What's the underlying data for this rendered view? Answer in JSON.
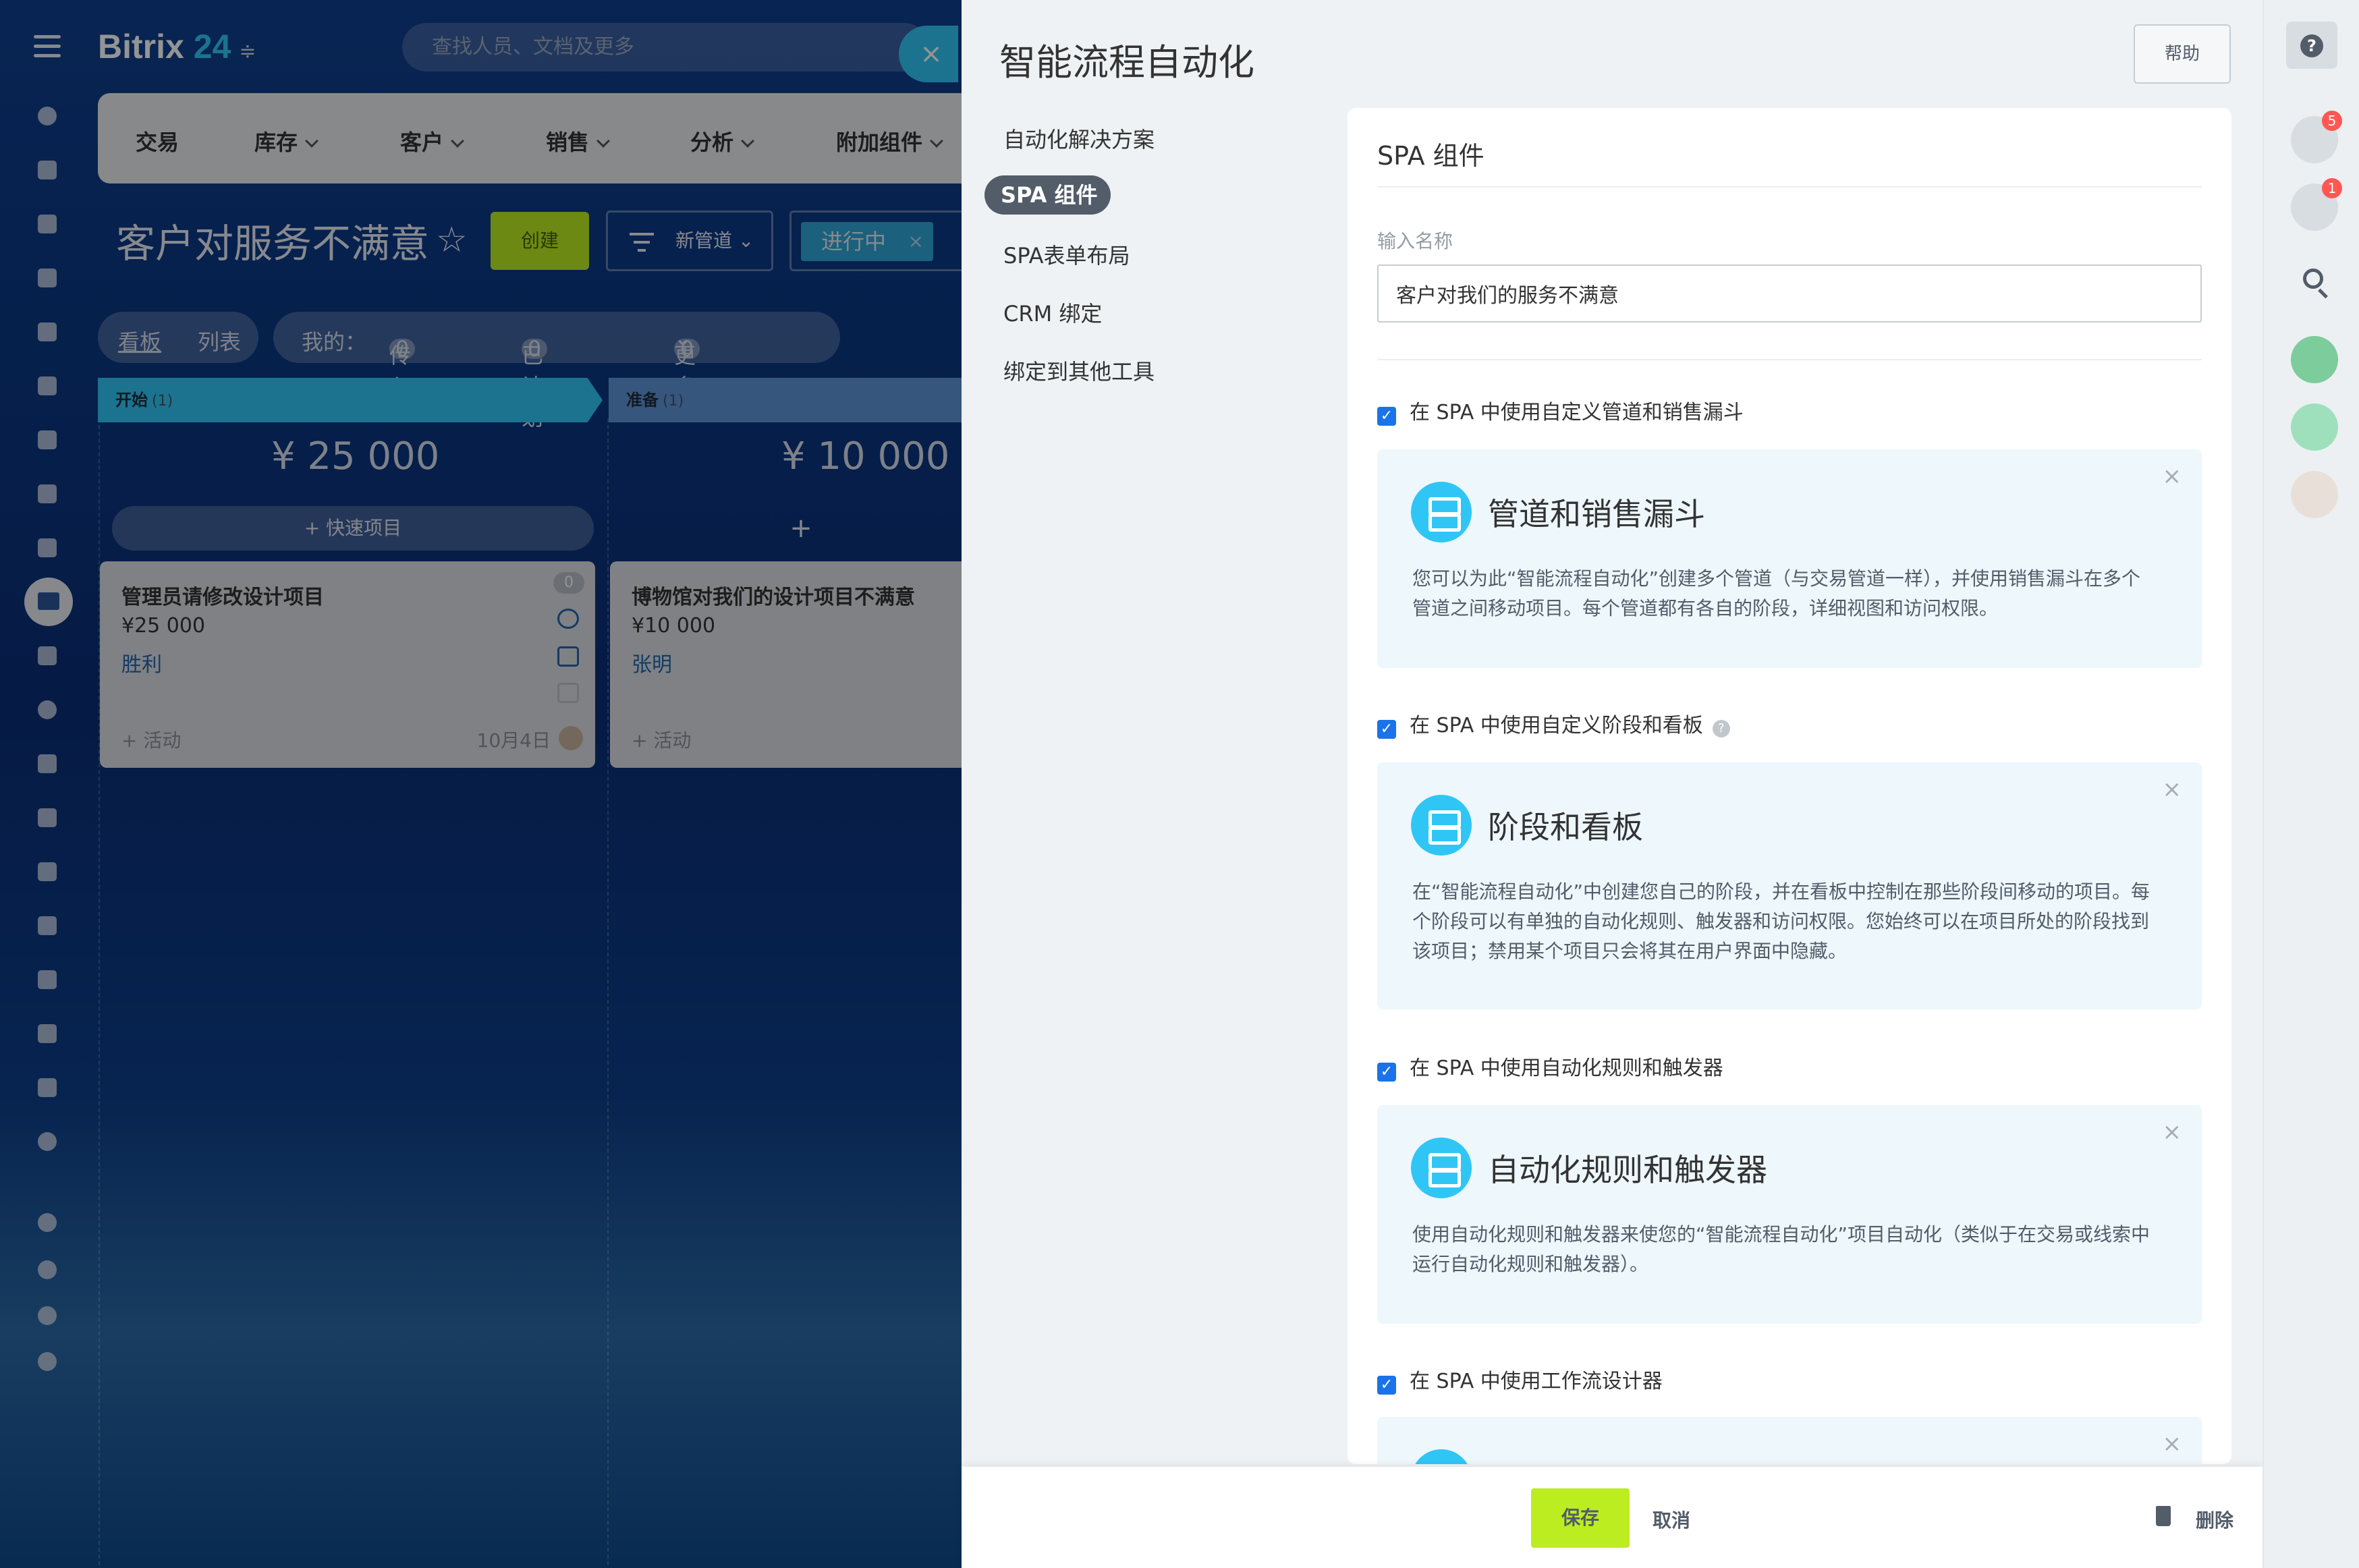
{
  "background_app": {
    "brand": {
      "name": "Bitrix",
      "number": "24",
      "suffix": "≑"
    },
    "search_placeholder": "查找人员、文档及更多",
    "crm_tabs": [
      "交易",
      "库存",
      "客户",
      "销售",
      "分析",
      "附加组件"
    ],
    "page_title": "客户对服务不满意",
    "create_label": "创建",
    "pipeline_label": "新管道",
    "filter_tag": "进行中",
    "views": {
      "kanban": "看板",
      "list": "列表"
    },
    "my": {
      "label": "我的：",
      "incoming": "传入",
      "planned": "已计划",
      "more": "更多",
      "incoming_count": "0",
      "planned_count": "0",
      "more_count": "0"
    },
    "columns": [
      {
        "name": "开始",
        "count": "(1)",
        "sum": "¥ 25 000",
        "quick": "+ 快速项目",
        "color": "#2fc6f6"
      },
      {
        "name": "准备",
        "count": "(1)",
        "sum": "¥ 10 000",
        "quick": "+",
        "color": "#5f95d8"
      }
    ],
    "cards": [
      {
        "title": "管理员请修改设计项目",
        "price": "¥25 000",
        "responsible": "胜利",
        "activity": "+ 活动",
        "date": "10月4日",
        "badge": "0"
      },
      {
        "title": "博物馆对我们的设计项目不满意",
        "price": "¥10 000",
        "responsible": "张明",
        "activity": "+ 活动"
      }
    ],
    "close_icon": "×"
  },
  "panel": {
    "title": "智能流程自动化",
    "help": "帮助",
    "nav": [
      "自动化解决方案",
      "SPA 组件",
      "SPA表单布局",
      "CRM 绑定",
      "绑定到其他工具"
    ],
    "nav_active_index": 1,
    "section_title": "SPA 组件",
    "name_label": "输入名称",
    "name_value": "客户对我们的服务不满意",
    "options": [
      {
        "label": "在 SPA 中使用自定义管道和销售漏斗",
        "checked": true,
        "help": false,
        "title": "管道和销售漏斗",
        "body": "您可以为此“智能流程自动化”创建多个管道（与交易管道一样），并使用销售漏斗在多个管道之间移动项目。每个管道都有各自的阶段，详细视图和访问权限。"
      },
      {
        "label": "在 SPA 中使用自定义阶段和看板",
        "checked": true,
        "help": true,
        "title": "阶段和看板",
        "body": "在“智能流程自动化”中创建您自己的阶段，并在看板中控制在那些阶段间移动的项目。每个阶段可以有单独的自动化规则、触发器和访问权限。您始终可以在项目所处的阶段找到该项目；禁用某个项目只会将其在用户界面中隐藏。"
      },
      {
        "label": "在 SPA 中使用自动化规则和触发器",
        "checked": true,
        "help": false,
        "title": "自动化规则和触发器",
        "body": "使用自动化规则和触发器来使您的“智能流程自动化”项目自动化（类似于在交易或线索中运行自动化规则和触发器）。"
      },
      {
        "label": "在 SPA 中使用工作流设计器",
        "checked": true,
        "help": false,
        "title": "",
        "body": ""
      }
    ],
    "footer": {
      "save": "保存",
      "cancel": "取消",
      "delete": "删除"
    }
  },
  "right_bar": {
    "help_icon": "?",
    "notifications_badge": "5",
    "chat_badge": "1"
  },
  "colors": {
    "accent": "#2fc6f6",
    "primary_button": "#bbed21",
    "checkbox": "#1a73e8"
  }
}
